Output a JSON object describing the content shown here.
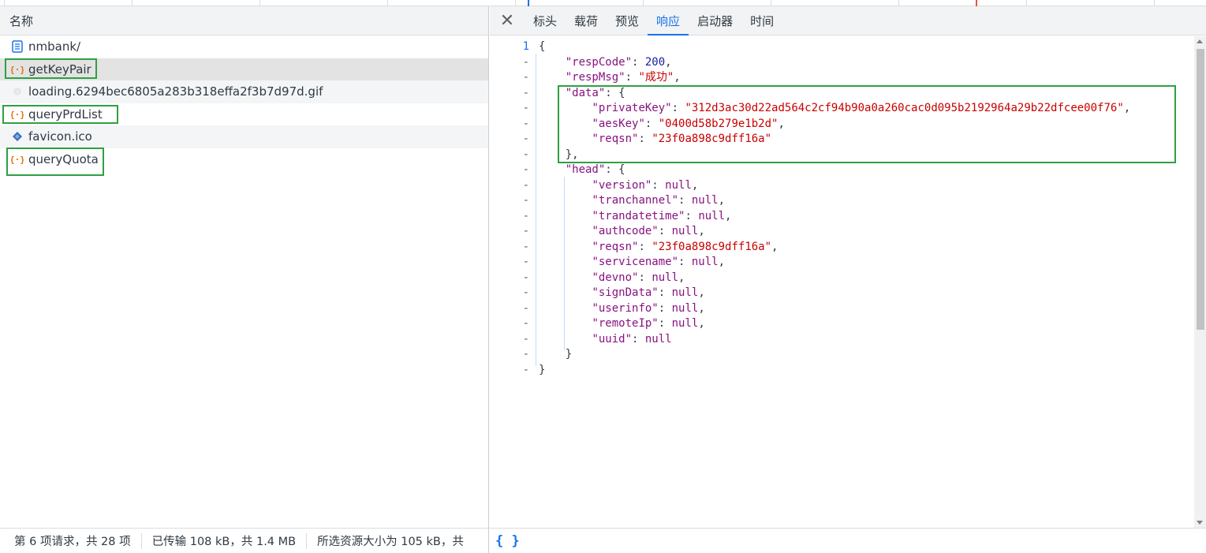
{
  "left": {
    "column_header": "名称",
    "requests": [
      {
        "name": "nmbank/",
        "icon": "document-icon"
      },
      {
        "name": "getKeyPair",
        "icon": "fetch-icon"
      },
      {
        "name": "loading.6294bec6805a283b318effa2f3b7d97d.gif",
        "icon": "image-icon"
      },
      {
        "name": "queryPrdList",
        "icon": "fetch-icon"
      },
      {
        "name": "favicon.ico",
        "icon": "favicon-icon"
      },
      {
        "name": "queryQuota",
        "icon": "fetch-icon"
      }
    ]
  },
  "right": {
    "close_icon": "close-icon",
    "tabs": [
      "标头",
      "载荷",
      "预览",
      "响应",
      "启动器",
      "时间"
    ],
    "active_tab": "响应",
    "code": {
      "line_number": "1",
      "fold_marker": "-",
      "lines": {
        "open": "{",
        "respCode_key": "\"respCode\"",
        "respCode_val": "200",
        "respMsg_key": "\"respMsg\"",
        "respMsg_val": "\"成功\"",
        "data_key": "\"data\"",
        "privateKey_key": "\"privateKey\"",
        "privateKey_val": "\"312d3ac30d22ad564c2cf94b90a0a260cac0d095b2192964a29b22dfcee00f76\"",
        "aesKey_key": "\"aesKey\"",
        "aesKey_val": "\"0400d58b279e1b2d\"",
        "reqsn_key": "\"reqsn\"",
        "reqsn_val": "\"23f0a898c9dff16a\"",
        "head_key": "\"head\"",
        "version_key": "\"version\"",
        "tranchannel_key": "\"tranchannel\"",
        "trandatetime_key": "\"trandatetime\"",
        "authcode_key": "\"authcode\"",
        "head_reqsn_key": "\"reqsn\"",
        "head_reqsn_val": "\"23f0a898c9dff16a\"",
        "servicename_key": "\"servicename\"",
        "devno_key": "\"devno\"",
        "signData_key": "\"signData\"",
        "userinfo_key": "\"userinfo\"",
        "remoteIp_key": "\"remoteIp\"",
        "uuid_key": "\"uuid\"",
        "null": "null"
      }
    }
  },
  "status": {
    "requests": "第 6 项请求，共 28 项",
    "transferred": "已传输 108 kB，共 1.4 MB",
    "resources": "所选资源大小为 105 kB，共",
    "pretty_print": "{ }"
  },
  "colors": {
    "accent": "#1a73e8",
    "highlight_box": "#2ea043",
    "json_key": "#881280",
    "json_string": "#c80000",
    "json_number": "#1a1aa6"
  }
}
